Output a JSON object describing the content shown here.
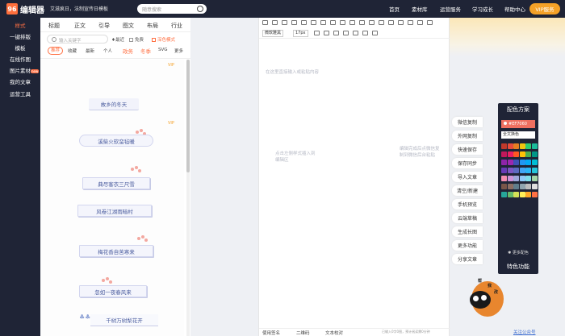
{
  "header": {
    "logo_text": "编辑器",
    "logo_mark": "96",
    "promo": "艾滋疯日，法制宣传日模板",
    "search_placeholder": "随意搜索",
    "nav": [
      "首页",
      "素材库",
      "运营服务",
      "学习成长",
      "帮助中心"
    ],
    "vip_label": "VIP服务"
  },
  "sidebar": {
    "items": [
      "样式",
      "一键排版",
      "模板",
      "在线作图",
      "图片素材",
      "我的文章",
      "运营工具"
    ],
    "badge": "new"
  },
  "panel": {
    "tabs": [
      "标题",
      "正文",
      "引导",
      "图文",
      "布局",
      "行业"
    ],
    "search_placeholder": "输入关键字",
    "options": [
      "最近",
      "免费",
      "深色模式"
    ],
    "filters": [
      "推荐",
      "收藏",
      "最新",
      "个人",
      "政务",
      "冬季",
      "SVG",
      "更多"
    ],
    "templates": [
      "故乡的冬天",
      "溪柴火软蛮毡暖",
      "典尽客衣三尺雪",
      "风卷江湖雨暗村",
      "梅花香自苦寒来",
      "忽如一夜春风来",
      "千树万树梨花开"
    ],
    "crown_label": "VIP"
  },
  "editor": {
    "font_label": "微软雅黑",
    "size_label": "17px",
    "hint_top": "在这里直接输入或粘贴内容",
    "hint_mid": "点击左侧样式插入到编辑区",
    "hint_right": "编辑完成后点微信复制到微信后台粘贴",
    "footer": [
      "使用签名",
      "二维码",
      "文本校对"
    ],
    "count": "已输入0字0图，预计阅读需0分钟"
  },
  "actions": [
    "微信复制",
    "外网复制",
    "快速保存",
    "保存同步",
    "导入文章",
    "清空/新建",
    "手机预览",
    "云端草稿",
    "生成长图",
    "更多功能",
    "分享文章"
  ],
  "color_panel": {
    "title": "配色方案",
    "value": "#EF7060",
    "mode": "全文换色",
    "more": "更多配色",
    "feature": "特色功能",
    "swatches": [
      "#c0392b",
      "#e74c3c",
      "#e67e22",
      "#f1c40f",
      "#2ecc71",
      "#1abc9c",
      "#c2185b",
      "#e91e63",
      "#ff5722",
      "#ffc107",
      "#4caf50",
      "#009688",
      "#8e24aa",
      "#9c27b0",
      "#3f51b5",
      "#2196f3",
      "#03a9f4",
      "#00bcd4",
      "#673ab7",
      "#7e57c2",
      "#5c6bc0",
      "#42a5f5",
      "#29b6f6",
      "#26c6da",
      "#f48fb1",
      "#ce93d8",
      "#9fa8da",
      "#90caf9",
      "#80deea",
      "#a5d6a7",
      "#795548",
      "#8d6e63",
      "#607d8b",
      "#90a4ae",
      "#bdbdbd",
      "#e0e0e0",
      "#26a69a",
      "#66bb6a",
      "#d4e157",
      "#ffee58",
      "#ffa726",
      "#ff7043"
    ]
  },
  "mascot": {
    "text": [
      "帮",
      "我",
      "改"
    ]
  },
  "footer": {
    "follow": "关注公众号"
  }
}
